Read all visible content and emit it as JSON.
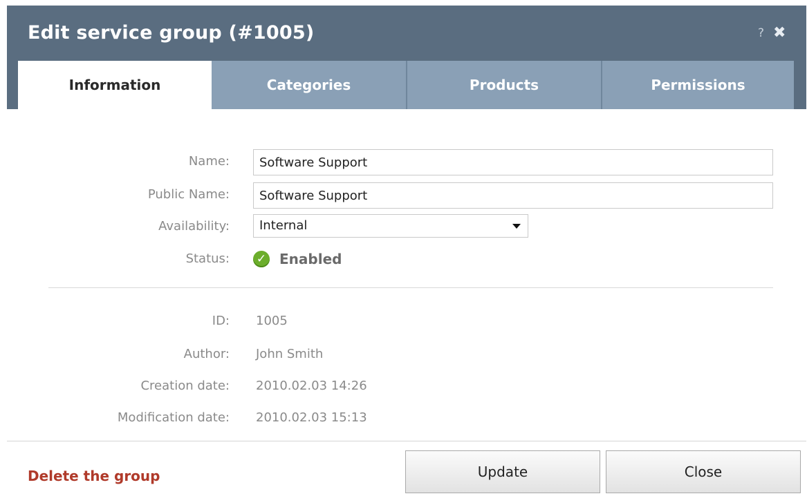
{
  "dialog": {
    "title": "Edit service group (#1005)",
    "help_label": "?",
    "close_label": "✖"
  },
  "tabs": [
    {
      "label": "Information",
      "active": true
    },
    {
      "label": "Categories",
      "active": false
    },
    {
      "label": "Products",
      "active": false
    },
    {
      "label": "Permissions",
      "active": false
    }
  ],
  "form": {
    "name_label": "Name:",
    "name_value": "Software Support",
    "public_name_label": "Public Name:",
    "public_name_value": "Software Support",
    "availability_label": "Availability:",
    "availability_value": "Internal",
    "status_label": "Status:",
    "status_value": "Enabled",
    "status_icon": "check-circle-icon"
  },
  "info": {
    "id_label": "ID:",
    "id_value": "1005",
    "author_label": "Author:",
    "author_value": "John Smith",
    "creation_label": "Creation date:",
    "creation_value": "2010.02.03 14:26",
    "modification_label": "Modification date:",
    "modification_value": "2010.02.03 15:13"
  },
  "footer": {
    "delete_label": "Delete the group",
    "update_label": "Update",
    "close_label": "Close"
  },
  "colors": {
    "titlebar": "#5a6d80",
    "tab_inactive": "#8aa0b6",
    "delete_link": "#b03a2a",
    "status_ok": "#6cae2c"
  }
}
